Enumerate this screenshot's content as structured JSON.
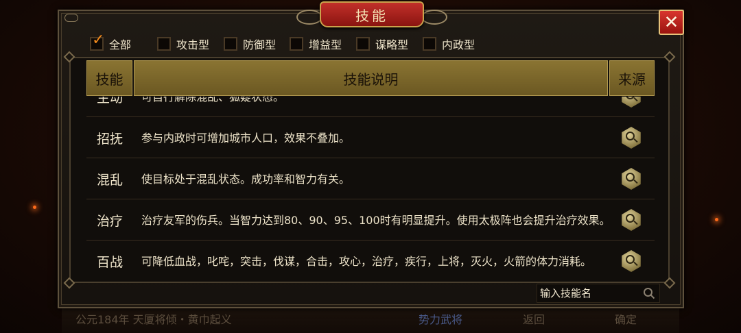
{
  "dialog": {
    "title": "技能",
    "close_symbol": "✕"
  },
  "filters": [
    {
      "label": "全部",
      "checked": true
    },
    {
      "label": "攻击型",
      "checked": false
    },
    {
      "label": "防御型",
      "checked": false
    },
    {
      "label": "增益型",
      "checked": false
    },
    {
      "label": "谋略型",
      "checked": false
    },
    {
      "label": "内政型",
      "checked": false
    }
  ],
  "table": {
    "headers": {
      "skill": "技能",
      "description": "技能说明",
      "source": "来源"
    },
    "rows": [
      {
        "name": "主动",
        "desc": "可自行解除混乱、狐疑状态。"
      },
      {
        "name": "招抚",
        "desc": "参与内政时可增加城市人口，效果不叠加。"
      },
      {
        "name": "混乱",
        "desc": "使目标处于混乱状态。成功率和智力有关。"
      },
      {
        "name": "治疗",
        "desc": "治疗友军的伤兵。当智力达到80、90、95、100时有明显提升。使用太极阵也会提升治疗效果。"
      },
      {
        "name": "百战",
        "desc": "可降低血战，叱咤，突击，伐谋，合击，攻心，治疗，疾行，上将，灭火，火箭的体力消耗。"
      }
    ]
  },
  "search": {
    "placeholder": "输入技能名"
  },
  "background_bar": {
    "left_text": "公元184年 天厦将倾・黄巾起义",
    "mid_text": "势力武将",
    "back_text": "返回",
    "confirm_text": "确定"
  },
  "colors": {
    "accent": "#f28a1c",
    "header_gold": "#8a7432",
    "close_red": "#c2302a"
  }
}
